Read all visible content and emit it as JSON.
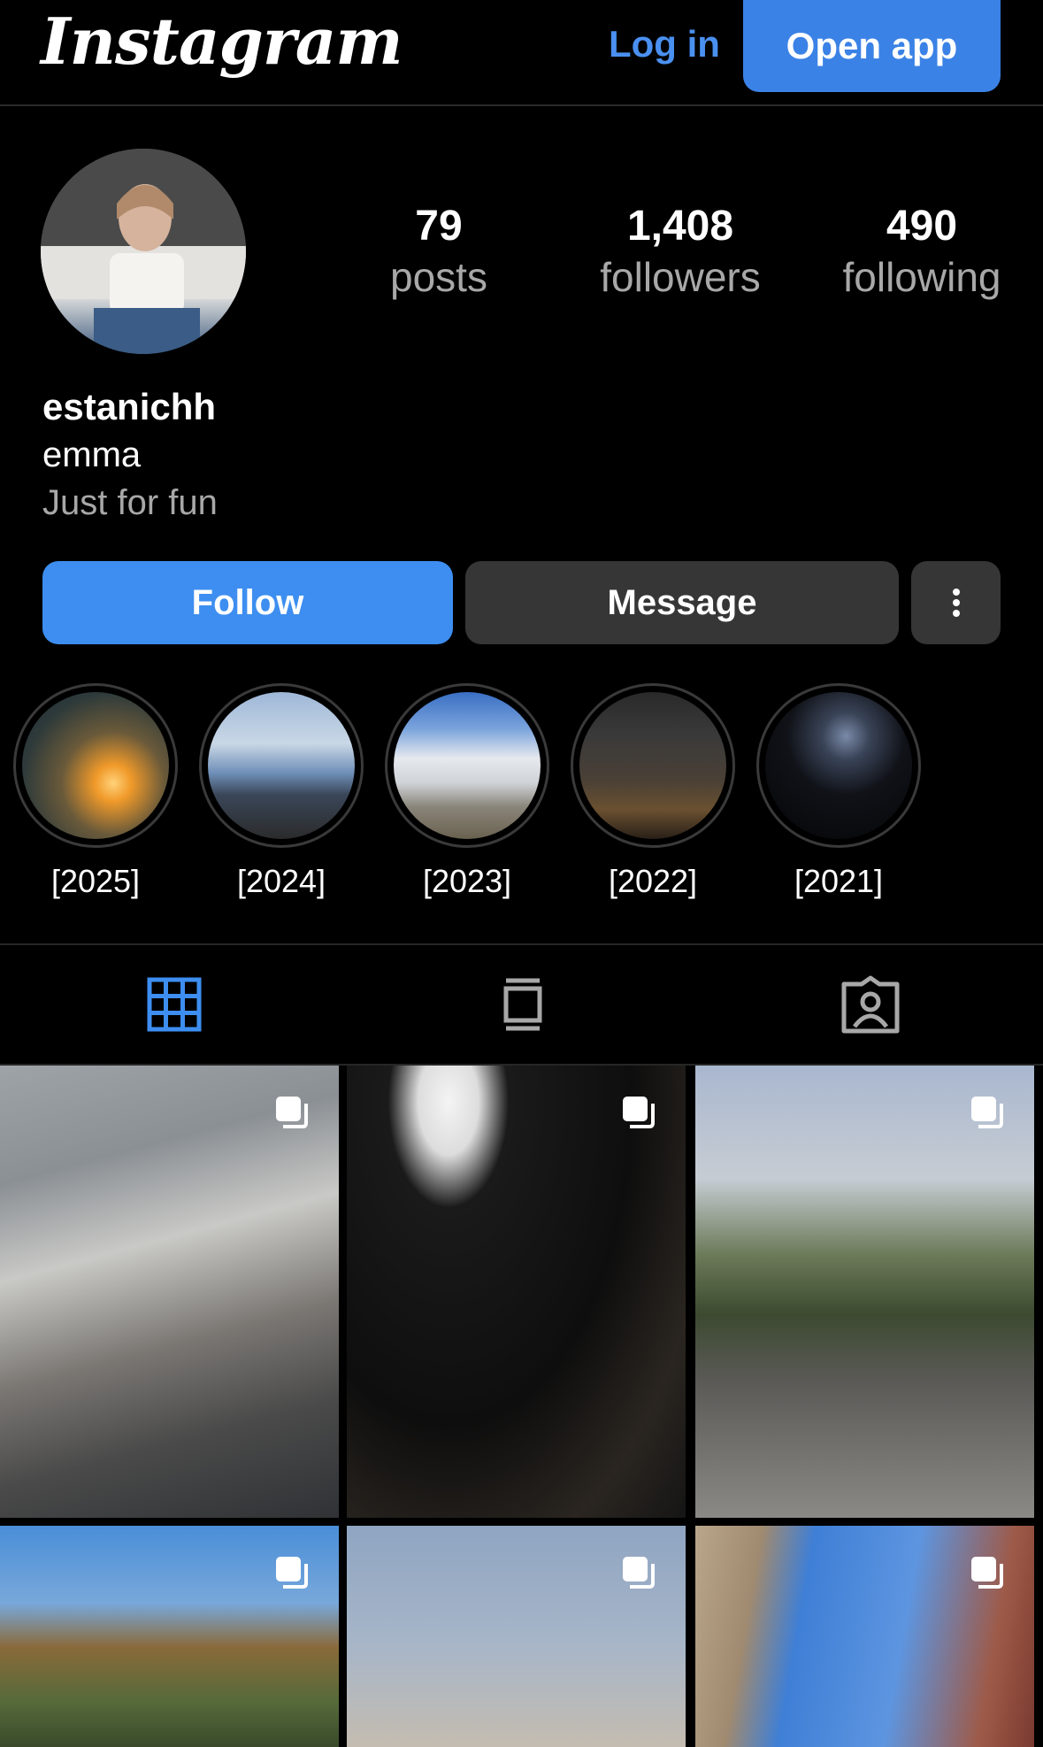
{
  "header": {
    "logo": "Instagram",
    "login_label": "Log in",
    "open_app_label": "Open app"
  },
  "profile": {
    "stats": [
      {
        "value": "79",
        "label": "posts"
      },
      {
        "value": "1,408",
        "label": "followers"
      },
      {
        "value": "490",
        "label": "following"
      }
    ],
    "username": "estanichh",
    "full_name": "emma",
    "bio": "Just for fun",
    "follow_label": "Follow",
    "message_label": "Message"
  },
  "highlights": [
    {
      "label": "[2025]"
    },
    {
      "label": "[2024]"
    },
    {
      "label": "[2023]"
    },
    {
      "label": "[2022]"
    },
    {
      "label": "[2021]"
    }
  ],
  "tabs": [
    {
      "icon": "grid-icon",
      "active": true
    },
    {
      "icon": "reels-icon",
      "active": false
    },
    {
      "icon": "tagged-icon",
      "active": false
    }
  ],
  "colors": {
    "accent": "#3d8ef0",
    "background": "#000000",
    "secondary_button": "#363636",
    "muted_text": "#a8a8a8"
  }
}
